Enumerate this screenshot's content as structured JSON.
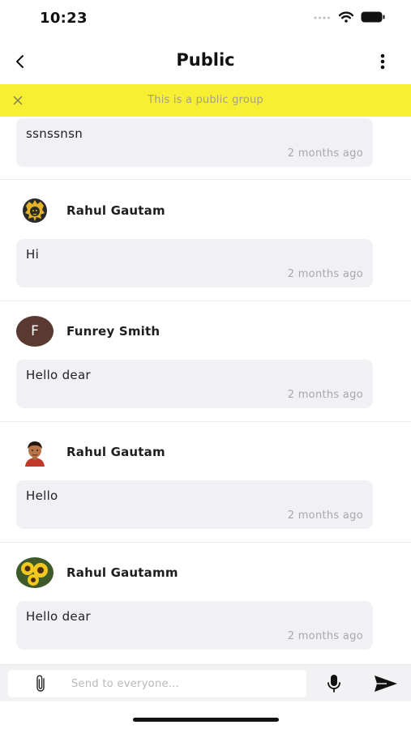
{
  "status_bar": {
    "time": "10:23",
    "icons": [
      "cellular-signal-icon",
      "wifi-icon",
      "battery-icon"
    ]
  },
  "header": {
    "back_icon": "chevron-left-icon",
    "title": "Public",
    "menu_icon": "more-vertical-icon"
  },
  "banner": {
    "close_icon": "close-icon",
    "text": "This is a public group",
    "color": "#f7f032"
  },
  "messages": [
    {
      "author": "",
      "avatar": "none",
      "text": "ssnssnsn",
      "time": "2 months ago"
    },
    {
      "author": "Rahul Gautam",
      "avatar": "lion-logo-avatar",
      "text": "Hi",
      "time": "2 months ago"
    },
    {
      "author": "Funrey Smith",
      "avatar_initial": "F",
      "avatar_color": "#5a3a30",
      "text": "Hello dear",
      "time": "2 months ago"
    },
    {
      "author": "Rahul Gautam",
      "avatar": "cartoon-person-avatar",
      "text": "Hello",
      "time": "2 months ago"
    },
    {
      "author": "Rahul Gautamm",
      "avatar": "sunflower-photo-avatar",
      "text": "Hello dear",
      "time": "2 months ago"
    }
  ],
  "composer": {
    "attach_icon": "paperclip-icon",
    "placeholder": "Send to everyone...",
    "value": "",
    "mic_icon": "microphone-icon",
    "send_icon": "send-icon"
  }
}
